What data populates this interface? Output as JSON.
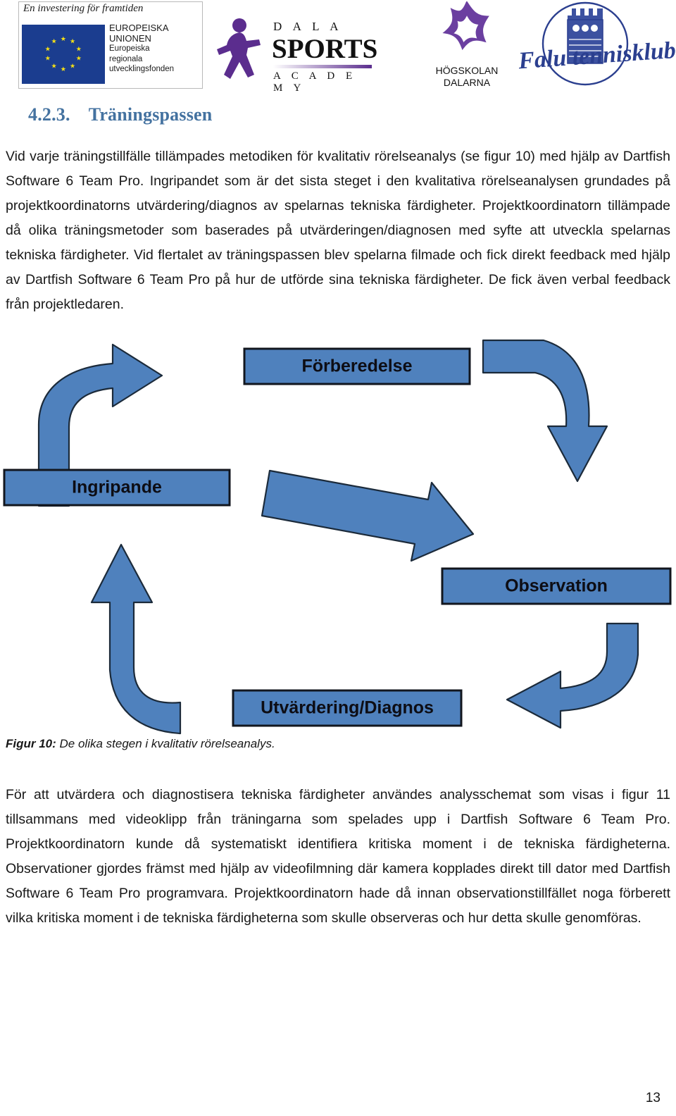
{
  "header": {
    "eu_logo": {
      "tagline": "En investering för framtiden",
      "line1": "EUROPEISKA",
      "line2": "UNIONEN",
      "line3": "Europeiska",
      "line4": "regionala",
      "line5": "utvecklingsfonden"
    },
    "dala_sports": {
      "dala": "D A L A",
      "sports": "SPORTS",
      "academy": "A C A D E M Y"
    },
    "hogskolan": {
      "line1": "HÖGSKOLAN",
      "line2": "DALARNA"
    },
    "falu": {
      "name": "Falu tennisklubb"
    }
  },
  "section": {
    "number": "4.2.3.",
    "title": "Träningspassen"
  },
  "body": {
    "paragraph_1": "Vid varje träningstillfälle tillämpades metodiken för kvalitativ rörelseanalys (se figur 10) med hjälp av Dartfish Software 6 Team Pro. Ingripandet som är det sista steget i den kvalitativa rörelseanalysen grundades på projektkoordinatorns utvärdering/diagnos av spelarnas tekniska färdigheter. Projektkoordinatorn tillämpade då olika träningsmetoder som baserades på utvärderingen/diagnosen med syfte att utveckla spelarnas tekniska färdigheter. Vid flertalet av träningspassen blev spelarna filmade och fick direkt feedback med hjälp av Dartfish Software 6 Team Pro på hur de utförde sina tekniska färdigheter. De fick även verbal feedback från projektledaren.",
    "paragraph_2": "För att utvärdera och diagnostisera tekniska färdigheter användes analysschemat som visas i figur 11 tillsammans med videoklipp från träningarna som spelades upp i Dartfish Software 6 Team Pro. Projektkoordinatorn kunde då systematiskt identifiera kritiska moment i de tekniska färdigheterna. Observationer gjordes främst med hjälp av videofilmning där kamera kopplades direkt till dator med Dartfish Software 6 Team Pro programvara. Projektkoordinatorn hade då innan observationstillfället noga förberett vilka kritiska moment i de tekniska färdigheterna som skulle observeras och hur detta skulle genomföras."
  },
  "figure": {
    "caption_label": "Figur 10:",
    "caption_text": " De olika stegen i kvalitativ rörelseanalys.",
    "fill_color": "#4F81BD",
    "stroke_color": "#1b2a3a",
    "stages": [
      {
        "id": "forberedelse",
        "label": "Förberedelse"
      },
      {
        "id": "observation",
        "label": "Observation"
      },
      {
        "id": "utvardering-diagnos",
        "label": "Utvärdering/Diagnos"
      },
      {
        "id": "ingripande",
        "label": "Ingripande"
      }
    ]
  },
  "footer": {
    "page_number": "13"
  }
}
